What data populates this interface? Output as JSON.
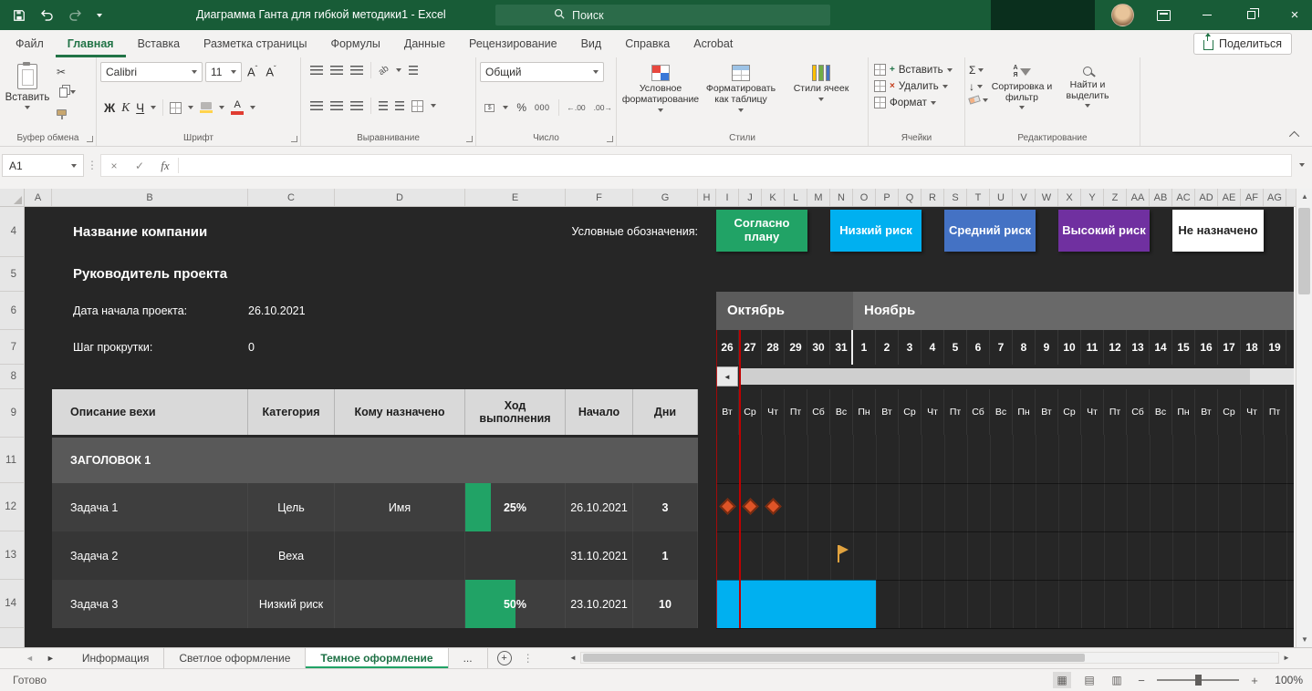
{
  "window": {
    "title": "Диаграмма Ганта для гибкой методики1 - Excel",
    "search_placeholder": "Поиск"
  },
  "ribbon": {
    "tabs": [
      {
        "label": "Файл",
        "active": false
      },
      {
        "label": "Главная",
        "active": true
      },
      {
        "label": "Вставка",
        "active": false
      },
      {
        "label": "Разметка страницы",
        "active": false
      },
      {
        "label": "Формулы",
        "active": false
      },
      {
        "label": "Данные",
        "active": false
      },
      {
        "label": "Рецензирование",
        "active": false
      },
      {
        "label": "Вид",
        "active": false
      },
      {
        "label": "Справка",
        "active": false
      },
      {
        "label": "Acrobat",
        "active": false
      }
    ],
    "share_label": "Поделиться",
    "clipboard": {
      "paste": "Вставить",
      "group": "Буфер обмена"
    },
    "font": {
      "name": "Calibri",
      "size": "11",
      "bold": "Ж",
      "italic": "К",
      "underline": "Ч",
      "group": "Шрифт"
    },
    "alignment": {
      "group": "Выравнивание"
    },
    "number": {
      "format": "Общий",
      "percent": "%",
      "zeros": "000",
      "group": "Число"
    },
    "styles": {
      "buttons": [
        "Условное форматирование",
        "Форматировать как таблицу",
        "Стили ячеек"
      ],
      "group": "Стили"
    },
    "cells": {
      "buttons": [
        "Вставить",
        "Удалить",
        "Формат"
      ],
      "group": "Ячейки"
    },
    "editing": {
      "autosum": "Σ",
      "buttons": [
        "Сортировка и фильтр",
        "Найти и выделить"
      ],
      "group": "Редактирование"
    }
  },
  "formula_bar": {
    "name_box": "A1",
    "fx_label": "fx"
  },
  "grid": {
    "columns": [
      "A",
      "B",
      "C",
      "D",
      "E",
      "F",
      "G",
      "H",
      "I",
      "J",
      "K",
      "L",
      "M",
      "N",
      "O",
      "P",
      "Q",
      "R",
      "S",
      "T",
      "U",
      "V",
      "W",
      "X",
      "Y",
      "Z",
      "AA",
      "AB",
      "AC",
      "AD",
      "AE",
      "AF",
      "AG"
    ],
    "row_numbers": [
      "4",
      "5",
      "6",
      "7",
      "8",
      "9",
      "11",
      "12",
      "13",
      "14"
    ]
  },
  "sheet": {
    "company_name": "Название компании",
    "project_lead": "Руководитель проекта",
    "legend_label": "Условные обозначения:",
    "legend": [
      {
        "label": "Согласно плану",
        "color": "#21A366",
        "text_color": "#FFFFFF"
      },
      {
        "label": "Низкий риск",
        "color": "#00B0F0",
        "text_color": "#FFFFFF"
      },
      {
        "label": "Средний риск",
        "color": "#4472C4",
        "text_color": "#FFFFFF"
      },
      {
        "label": "Высокий риск",
        "color": "#7030A0",
        "text_color": "#FFFFFF"
      },
      {
        "label": "Не назначено",
        "color": "#FFFFFF",
        "text_color": "#1F1F1F"
      }
    ],
    "start_date_label": "Дата начала проекта:",
    "start_date_value": "26.10.2021",
    "scroll_step_label": "Шаг прокрутки:",
    "scroll_step_value": "0",
    "table_headers": [
      "Описание вехи",
      "Категория",
      "Кому назначено",
      "Ход выполнения",
      "Начало",
      "Дни"
    ],
    "section_title": "ЗАГОЛОВОК 1",
    "tasks": [
      {
        "name": "Задача 1",
        "category": "Цель",
        "assignee": "Имя",
        "progress_label": "25%",
        "progress_pct": 25,
        "start": "26.10.2021",
        "days": "3",
        "gantt": {
          "type": "milestones",
          "day_indexes": [
            0,
            1,
            2
          ]
        }
      },
      {
        "name": "Задача 2",
        "category": "Веха",
        "assignee": "",
        "progress_label": "",
        "progress_pct": 0,
        "start": "31.10.2021",
        "days": "1",
        "gantt": {
          "type": "flag",
          "day_index": 5
        }
      },
      {
        "name": "Задача 3",
        "category": "Низкий риск",
        "assignee": "",
        "progress_label": "50%",
        "progress_pct": 50,
        "start": "23.10.2021",
        "days": "10",
        "gantt": {
          "type": "bar",
          "start_index": 0,
          "span": 7,
          "color": "#00B0F0"
        }
      }
    ],
    "gantt": {
      "months": [
        {
          "label": "Октябрь",
          "days": 6
        },
        {
          "label": "Ноябрь",
          "days": 19
        }
      ],
      "dates": [
        "26",
        "27",
        "28",
        "29",
        "30",
        "31",
        "1",
        "2",
        "3",
        "4",
        "5",
        "6",
        "7",
        "8",
        "9",
        "10",
        "11",
        "12",
        "13",
        "14",
        "15",
        "16",
        "17",
        "18",
        "19"
      ],
      "weekdays": [
        "Вт",
        "Ср",
        "Чт",
        "Пт",
        "Сб",
        "Вс",
        "Пн",
        "Вт",
        "Ср",
        "Чт",
        "Пт",
        "Сб",
        "Вс",
        "Пн",
        "Вт",
        "Ср",
        "Чт",
        "Пт",
        "Сб",
        "Вс",
        "Пн",
        "Вт",
        "Ср",
        "Чт",
        "Пт"
      ],
      "today_column_index": 0
    }
  },
  "sheet_tabs": {
    "tabs": [
      {
        "label": "Информация",
        "active": false
      },
      {
        "label": "Светлое оформление",
        "active": false
      },
      {
        "label": "Темное оформление",
        "active": true
      },
      {
        "label": "...",
        "active": false
      }
    ]
  },
  "status_bar": {
    "ready_label": "Готово",
    "zoom_value": "100%"
  },
  "colors": {
    "titlebar": "#185C37",
    "accent": "#217346",
    "sheet_bg": "#262626",
    "milestone": "#DF5427",
    "flag": "#E2A33F",
    "today_line": "#C00000",
    "progress": "#21A366"
  }
}
